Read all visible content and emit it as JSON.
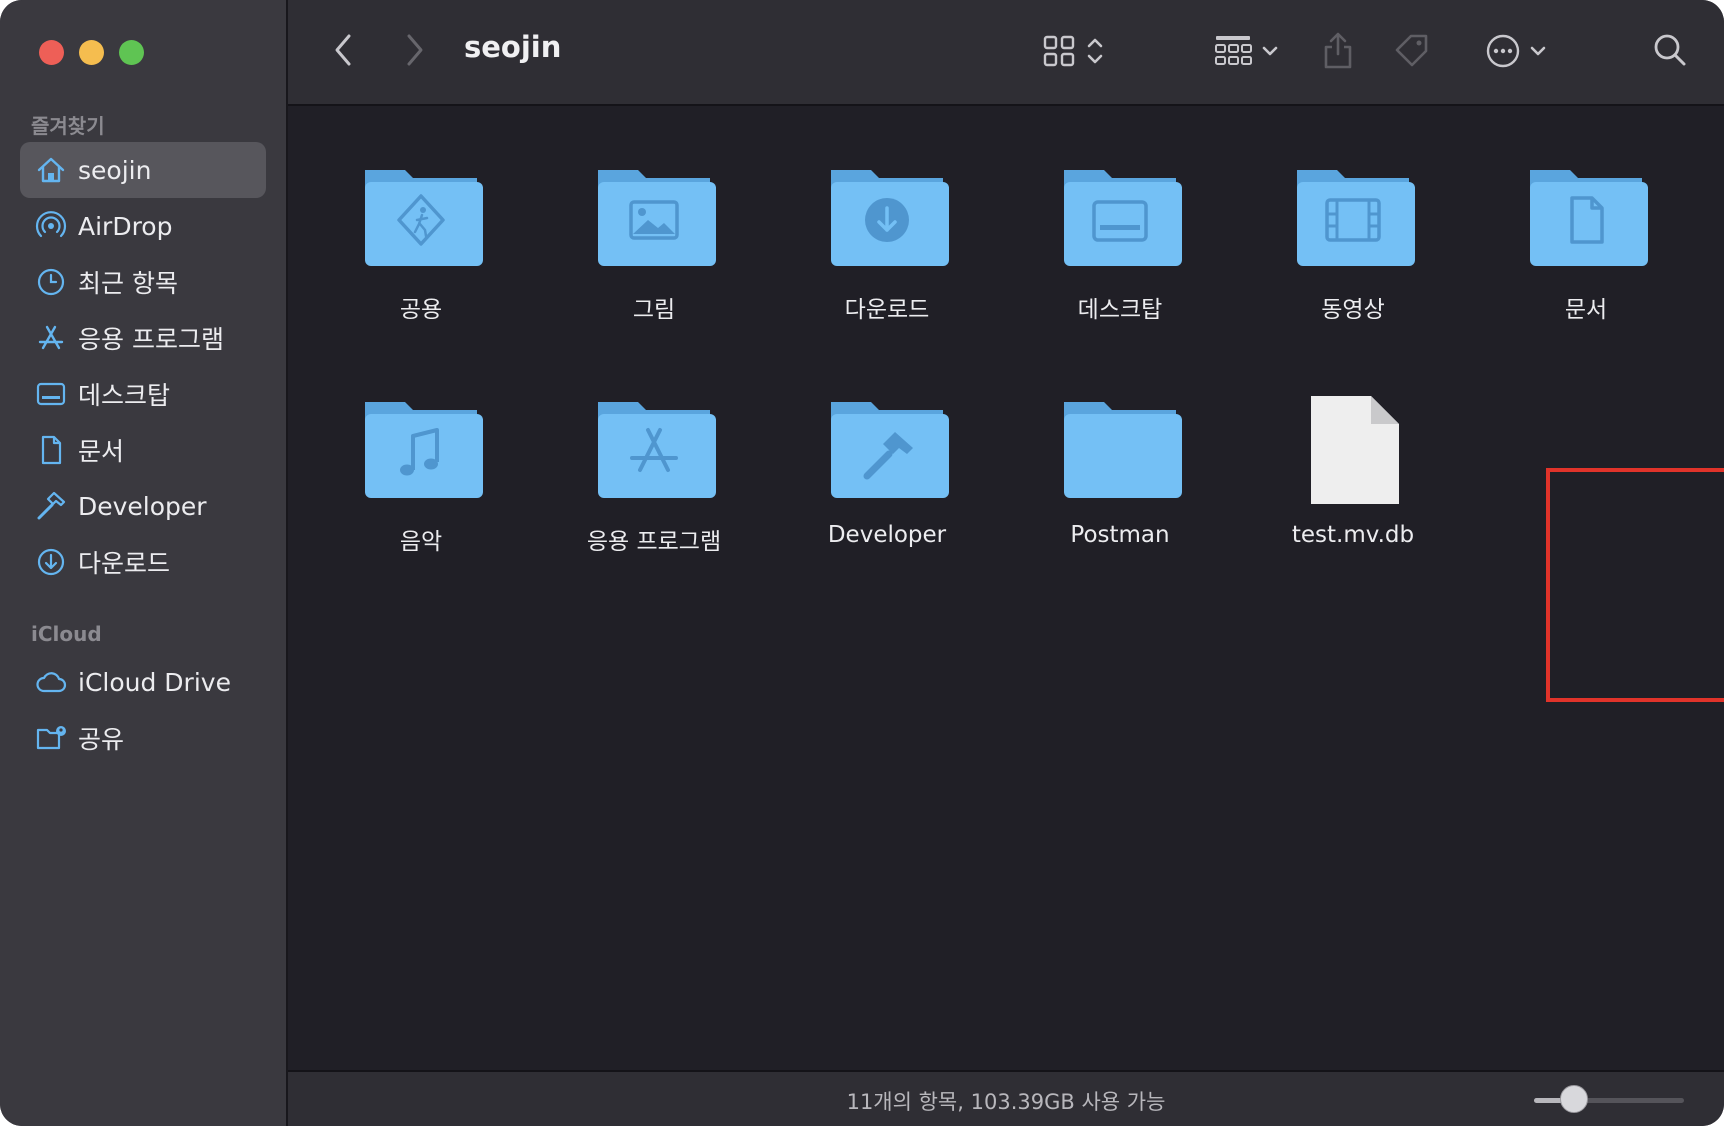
{
  "window": {
    "title": "seojin"
  },
  "sidebar": {
    "favorites_label": "즐겨찾기",
    "icloud_label": "iCloud",
    "favorites": [
      {
        "label": "seojin",
        "icon": "home-icon",
        "selected": true
      },
      {
        "label": "AirDrop",
        "icon": "airdrop-icon"
      },
      {
        "label": "최근 항목",
        "icon": "clock-icon"
      },
      {
        "label": "응용 프로그램",
        "icon": "app-store-icon"
      },
      {
        "label": "데스크탑",
        "icon": "desktop-icon"
      },
      {
        "label": "문서",
        "icon": "document-icon"
      },
      {
        "label": "Developer",
        "icon": "hammer-icon"
      },
      {
        "label": "다운로드",
        "icon": "download-icon"
      }
    ],
    "icloud": [
      {
        "label": "iCloud Drive",
        "icon": "cloud-icon"
      },
      {
        "label": "공유",
        "icon": "shared-folder-icon"
      }
    ]
  },
  "toolbar": {
    "back_icon": "chevron-left-icon",
    "forward_icon": "chevron-right-icon",
    "view_icon": "grid-view-icon",
    "group_icon": "group-by-icon",
    "share_icon": "share-icon",
    "tag_icon": "tag-icon",
    "action_icon": "more-actions-icon",
    "search_icon": "search-icon"
  },
  "items": [
    {
      "name": "공용",
      "icon": "public-folder-icon"
    },
    {
      "name": "그림",
      "icon": "pictures-folder-icon"
    },
    {
      "name": "다운로드",
      "icon": "downloads-folder-icon"
    },
    {
      "name": "데스크탑",
      "icon": "desktop-folder-icon"
    },
    {
      "name": "동영상",
      "icon": "movies-folder-icon"
    },
    {
      "name": "문서",
      "icon": "documents-folder-icon"
    },
    {
      "name": "음악",
      "icon": "music-folder-icon"
    },
    {
      "name": "응용 프로그램",
      "icon": "applications-folder-icon"
    },
    {
      "name": "Developer",
      "icon": "developer-folder-icon"
    },
    {
      "name": "Postman",
      "icon": "folder-icon"
    },
    {
      "name": "test.mv.db",
      "icon": "file-icon",
      "highlighted": true
    }
  ],
  "status": {
    "text": "11개의 항목, 103.39GB 사용 가능",
    "icon_size_level": 0.25
  },
  "colors": {
    "accent": "#64b5f0",
    "highlight_border": "#e0332a",
    "folder": "#74c0f5",
    "folder_back": "#5aa5de"
  }
}
